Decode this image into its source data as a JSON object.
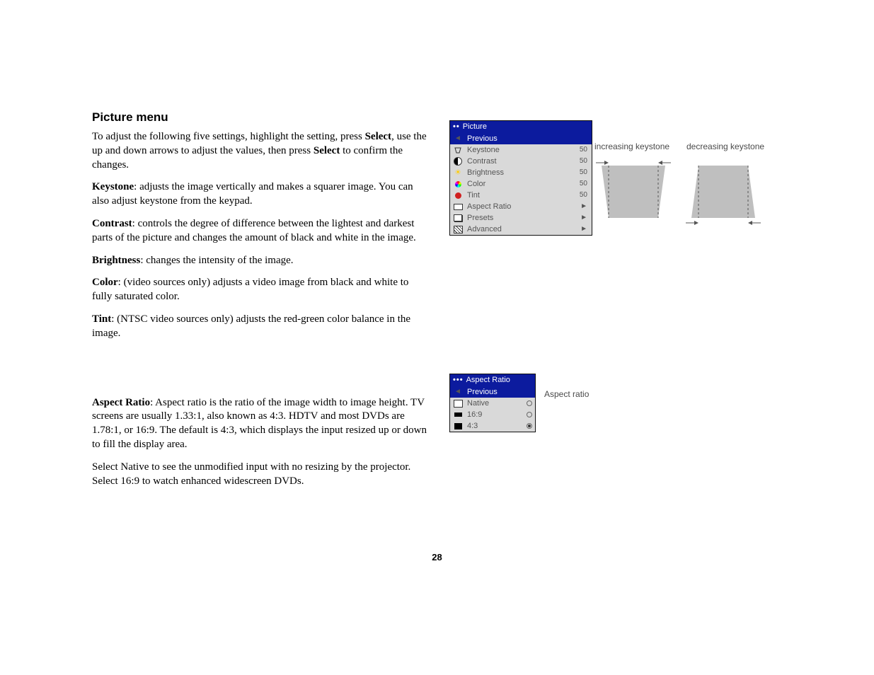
{
  "heading": "Picture menu",
  "intro_a": "To adjust the following five settings, highlight the setting, press ",
  "intro_select1": "Select",
  "intro_b": ", use the up and down arrows to adjust the values, then press ",
  "intro_select2": "Select",
  "intro_c": " to confirm the changes.",
  "keystone_term": "Keystone",
  "keystone_text": ": adjusts the image vertically and makes a squarer image. You can also adjust keystone from the keypad.",
  "contrast_term": "Contrast",
  "contrast_text": ": controls the degree of difference between the lightest and darkest parts of the picture and changes the amount of black and white in the image.",
  "brightness_term": "Brightness",
  "brightness_text": ": changes the intensity of the image.",
  "color_term": "Color",
  "color_text": ": (video sources only) adjusts a video image from black and white to fully saturated color.",
  "tint_term": "Tint",
  "tint_text": ": (NTSC video sources only) adjusts the red-green color balance in the image.",
  "aspect_term": "Aspect Ratio",
  "aspect_text": ": Aspect ratio is the ratio of the image width to image height. TV screens are usually 1.33:1, also known as 4:3. HDTV and most DVDs are 1.78:1, or 16:9. The default is 4:3, which displays the input resized up or down to fill the display area.",
  "aspect_p2": "Select Native to see the unmodified input with no resizing by the projector. Select 16:9 to watch enhanced widescreen DVDs.",
  "page_number": "28",
  "osd1": {
    "title": "Picture",
    "items": [
      {
        "label": "Previous",
        "value": "",
        "sel": true
      },
      {
        "label": "Keystone",
        "value": "50"
      },
      {
        "label": "Contrast",
        "value": "50"
      },
      {
        "label": "Brightness",
        "value": "50"
      },
      {
        "label": "Color",
        "value": "50"
      },
      {
        "label": "Tint",
        "value": "50"
      },
      {
        "label": "Aspect Ratio",
        "value": "►"
      },
      {
        "label": "Presets",
        "value": "►"
      },
      {
        "label": "Advanced",
        "value": "►"
      }
    ]
  },
  "osd2": {
    "title": "Aspect Ratio",
    "items": [
      {
        "label": "Previous",
        "sel": true
      },
      {
        "label": "Native",
        "checked": false
      },
      {
        "label": "16:9",
        "checked": false
      },
      {
        "label": "4:3",
        "checked": true
      }
    ]
  },
  "cap_increasing": "increasing keystone",
  "cap_decreasing": "decreasing keystone",
  "cap_aspect": "Aspect ratio"
}
